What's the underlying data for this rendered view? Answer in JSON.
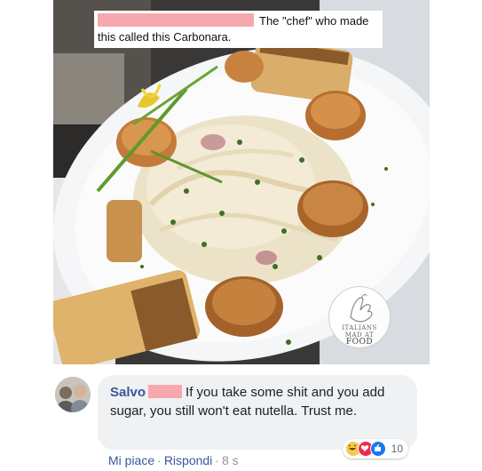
{
  "post": {
    "caption_line1": "The \"chef\" who made",
    "caption_line2": "this called this Carbonara.",
    "photo_icon": "pasta-with-scallops-photo",
    "logo": {
      "line1": "ITALIANS",
      "line2": "MAD AT",
      "line3": "FOOD"
    }
  },
  "comment": {
    "author": "Salvo",
    "text": "If you take some shit and you add sugar, you still won't eat nutella. Trust me.",
    "reaction_count": "10",
    "reactions": [
      "haha-icon",
      "love-icon",
      "like-icon"
    ],
    "actions": {
      "like": "Mi piace",
      "reply": "Rispondi",
      "separator": "·",
      "time": "8 s"
    }
  },
  "colors": {
    "link": "#385898",
    "bubble": "#eff1f3",
    "redaction": "#f7a8ae"
  }
}
